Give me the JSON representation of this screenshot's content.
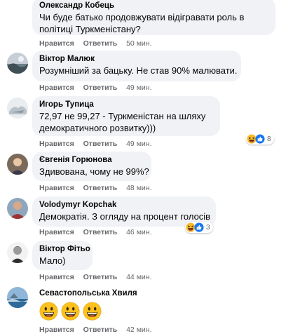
{
  "comments": [
    {
      "author": "Олександр Кобець",
      "lines": [
        "Чи буде батько продовжувати відігравати роль в",
        "політиці Туркменістану?"
      ],
      "like": "Нравится",
      "reply": "Ответить",
      "time": "50 мин."
    },
    {
      "author": "Віктор Малюк",
      "lines": [
        "Розумніший за бацьку. Не став 90% малювати."
      ],
      "like": "Нравится",
      "reply": "Ответить",
      "time": "49 мин."
    },
    {
      "author": "Игорь Тупица",
      "lines": [
        "72,97 не 99,27 - Туркменістан на шляху",
        "демократичного розвитку)))"
      ],
      "like": "Нравится",
      "reply": "Ответить",
      "time": "49 мин.",
      "reactions": {
        "count": "8",
        "icons": [
          "haha-icon",
          "like-icon"
        ]
      }
    },
    {
      "author": "Євгенія Горюнова",
      "lines": [
        "Здивована, чому не 99%?"
      ],
      "like": "Нравится",
      "reply": "Ответить",
      "time": "48 мин."
    },
    {
      "author": "Volodymyr Kopchak",
      "lines": [
        "Демократія. З огляду на процент голосів"
      ],
      "like": "Нравится",
      "reply": "Ответить",
      "time": "46 мин.",
      "reactions": {
        "count": "3",
        "icons": [
          "haha-icon",
          "like-icon"
        ]
      }
    },
    {
      "author": "Віктор Фітьо",
      "lines": [
        "Мало)"
      ],
      "like": "Нравится",
      "reply": "Ответить",
      "time": "44 мин."
    },
    {
      "author": "Севастопольська Хвиля",
      "emojis": [
        "grinning-face-icon",
        "grinning-face-icon",
        "grinning-face-icon"
      ],
      "like": "Нравится",
      "reply": "Ответить",
      "time": "42 мин."
    }
  ],
  "colors": {
    "bubble": "#f0f2f5",
    "meta_text": "#65676b",
    "like_blue": "#1877f2",
    "haha_yellow": "#f7b928"
  }
}
